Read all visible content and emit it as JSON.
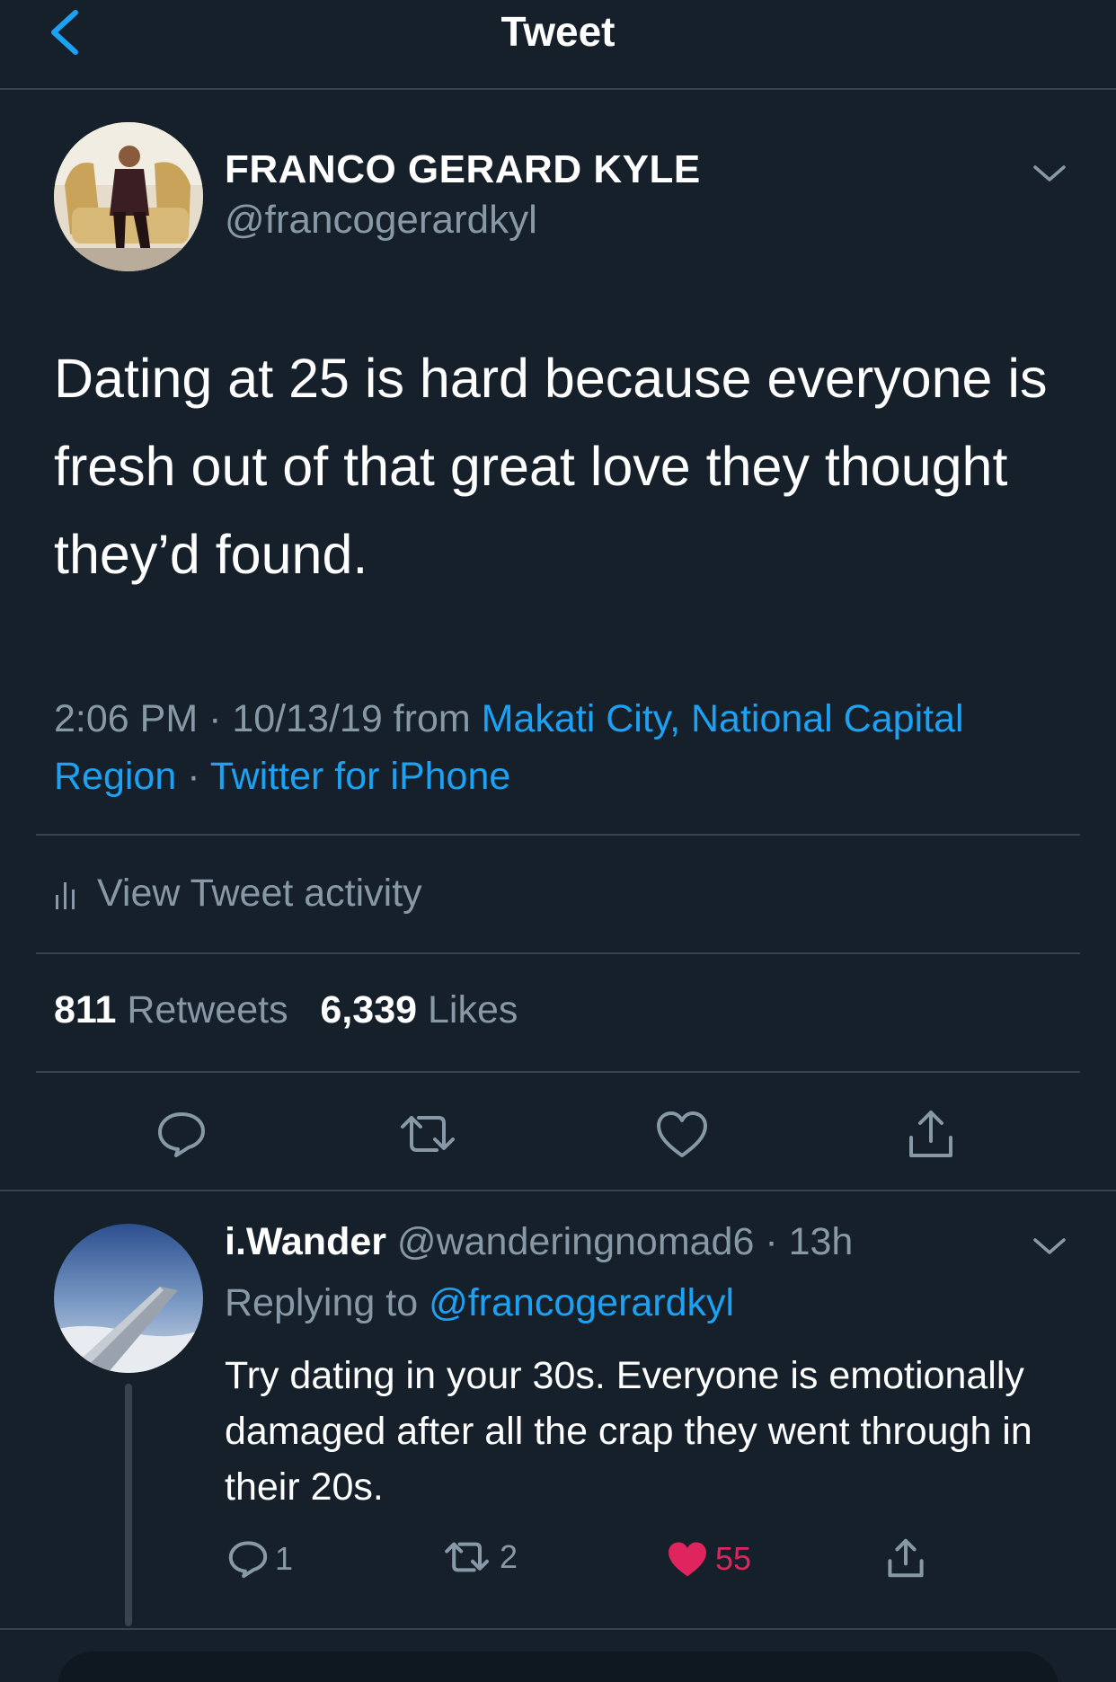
{
  "header": {
    "title": "Tweet",
    "back_icon": "chevron-left-icon"
  },
  "tweet": {
    "author_name": "FRANCO GERARD KYLE",
    "author_handle": "@francogerardkyl",
    "text": "Dating at 25 is hard because everyone is fresh out of that great love they thought they’d found.",
    "time": "2:06 PM · 10/13/19 from ",
    "location": "Makati City, National Capital Region",
    "separator": " · ",
    "client": "Twitter for iPhone",
    "activity_label": "View Tweet activity",
    "retweets_count": "811",
    "retweets_label": " Retweets",
    "likes_count": "6,339",
    "likes_label": " Likes"
  },
  "reply": {
    "name": "i.Wander",
    "handle": " @wanderingnomad6",
    "time": " · 13h",
    "replying_label": "Replying to ",
    "replying_handle": "@francogerardkyl",
    "text": "Try dating in your 30s. Everyone is emotionally damaged after all the crap they went through in their 20s.",
    "reply_count": "1",
    "retweet_count": "2",
    "like_count": "55"
  },
  "colors": {
    "background": "#15202b",
    "accent": "#1da1f2",
    "secondary_text": "#8899a6",
    "divider": "#38444d",
    "like": "#e0245e"
  }
}
